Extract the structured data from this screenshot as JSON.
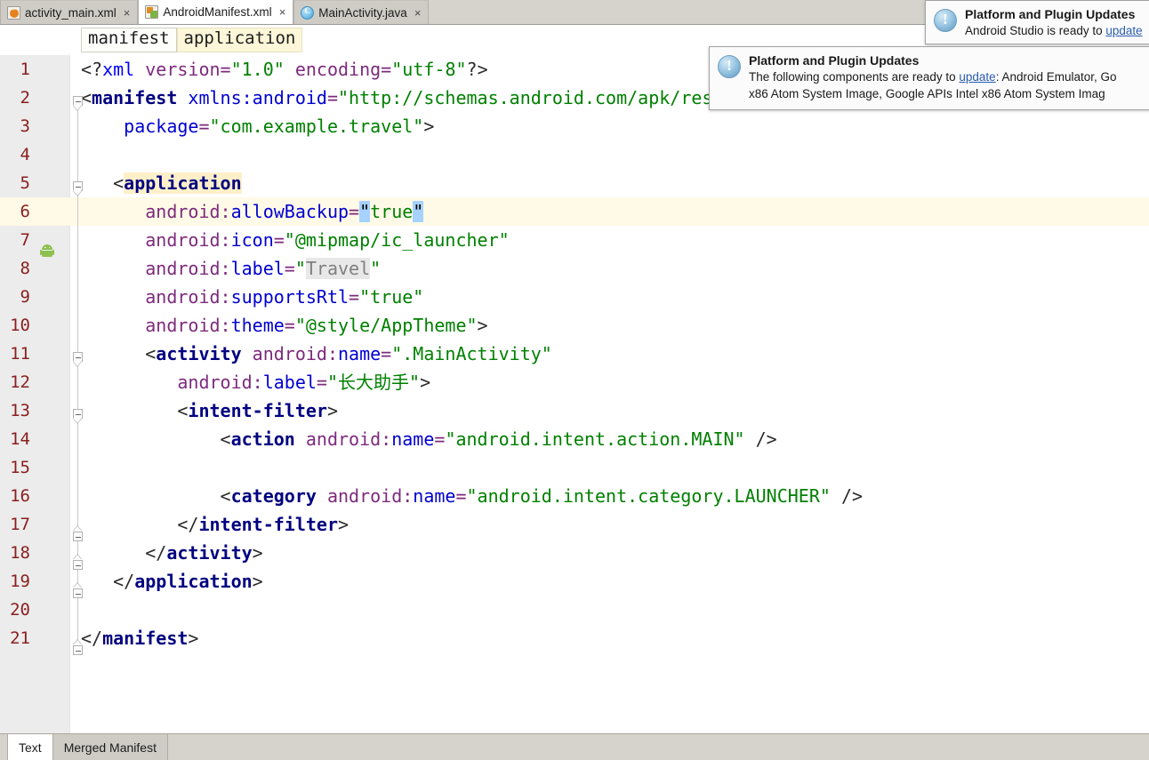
{
  "window": {
    "editor_tabs": [
      {
        "label": "activity_main.xml",
        "icon": "xml-file-icon",
        "active": false,
        "close": "×"
      },
      {
        "label": "AndroidManifest.xml",
        "icon": "android-manifest-icon",
        "active": true,
        "close": "×"
      },
      {
        "label": "MainActivity.java",
        "icon": "java-class-icon",
        "active": false,
        "close": "×"
      }
    ]
  },
  "breadcrumb": {
    "items": [
      {
        "label": "manifest",
        "highlight": false
      },
      {
        "label": "application",
        "highlight": true
      }
    ]
  },
  "editor": {
    "current_line": 6,
    "lines": [
      {
        "n": "1",
        "indent": 0
      },
      {
        "n": "2",
        "indent": 0
      },
      {
        "n": "3",
        "indent": 0
      },
      {
        "n": "4",
        "indent": 0
      },
      {
        "n": "5",
        "indent": 0
      },
      {
        "n": "6",
        "indent": 0
      },
      {
        "n": "7",
        "indent": 0
      },
      {
        "n": "8",
        "indent": 0
      },
      {
        "n": "9",
        "indent": 0
      },
      {
        "n": "10",
        "indent": 0
      },
      {
        "n": "11",
        "indent": 0
      },
      {
        "n": "12",
        "indent": 0
      },
      {
        "n": "13",
        "indent": 0
      },
      {
        "n": "14",
        "indent": 0
      },
      {
        "n": "15",
        "indent": 0
      },
      {
        "n": "16",
        "indent": 0
      },
      {
        "n": "17",
        "indent": 0
      },
      {
        "n": "18",
        "indent": 0
      },
      {
        "n": "19",
        "indent": 0
      },
      {
        "n": "20",
        "indent": 0
      },
      {
        "n": "21",
        "indent": 0
      }
    ],
    "code_text": {
      "l1": "<?xml version=\"1.0\" encoding=\"utf-8\"?>",
      "l2": "<manifest xmlns:android=\"http://schemas.android.com/apk/res/android\"",
      "l3": "        package=\"com.example.travel\">",
      "l4": "",
      "l5": "    <application",
      "l6": "        android:allowBackup=\"true\"",
      "l7": "        android:icon=\"@mipmap/ic_launcher\"",
      "l8": "        android:label=\"Travel\"",
      "l9": "        android:supportsRtl=\"true\"",
      "l10": "        android:theme=\"@style/AppTheme\">",
      "l11": "        <activity android:name=\".MainActivity\"",
      "l12": "            android:label=\"长大助手\">",
      "l13": "            <intent-filter>",
      "l14": "                <action android:name=\"android.intent.action.MAIN\" />",
      "l15": "",
      "l16": "                <category android:name=\"android.intent.category.LAUNCHER\" />",
      "l17": "            </intent-filter>",
      "l18": "        </activity>",
      "l19": "    </application>",
      "l20": "",
      "l21": "</manifest>"
    },
    "tokens": {
      "xml_decl_open": "<?",
      "xml_decl_name": "xml",
      "version_attr": " version=",
      "version_val": "\"1.0\"",
      "encoding_attr": " encoding=",
      "encoding_val": "\"utf-8\"",
      "xml_decl_close": "?>",
      "manifest_open": "<manifest",
      "xmlns_attr": " xmlns:android=",
      "xmlns_val": "\"http://schemas.android.com/apk/res/android\"",
      "package_attr": "package=",
      "package_val": "\"com.example.travel\"",
      "gt": ">",
      "application_open": "<application",
      "ns_android": "android:",
      "a_allowBackup": "allowBackup=",
      "v_true": "true",
      "quote": "\"",
      "a_icon": "icon=",
      "v_icon": "\"@mipmap/ic_launcher\"",
      "a_label": "label=",
      "v_travel": "\"Travel\"",
      "a_supportsRtl": "supportsRtl=",
      "v_true_q": "\"true\"",
      "a_theme": "theme=",
      "v_theme": "\"@style/AppTheme\"",
      "activity_open": "<activity",
      "a_name": "name=",
      "v_mainactivity": "\".MainActivity\"",
      "v_chinese_label": "\"长大助手\"",
      "intentfilter_open": "<intent-filter>",
      "action_open": "<action",
      "v_action_main": "\"android.intent.action.MAIN\"",
      "selfclose": " />",
      "category_open": "<category",
      "v_cat_launcher": "\"android.intent.category.LAUNCHER\"",
      "intentfilter_close": "</intent-filter>",
      "activity_close": "</activity>",
      "application_close": "</application>",
      "manifest_close": "</manifest>"
    },
    "gutter_icon_line": "7",
    "gutter_icon_name": "android-app-icon"
  },
  "notifications": [
    {
      "id": "notif-top-right",
      "title": "Platform and Plugin Updates",
      "body_prefix": "Android Studio is ready to ",
      "link": "update",
      "body_suffix": "",
      "icon": "info-icon"
    },
    {
      "id": "notif-main",
      "title": "Platform and Plugin Updates",
      "body_line1_prefix": "The following components are ready to ",
      "link": "update",
      "body_line1_suffix": ": Android Emulator, Go",
      "body_line2": "x86 Atom System Image, Google APIs Intel x86 Atom System Imag",
      "icon": "info-icon"
    }
  ],
  "bottom_tabs": [
    {
      "label": "Text",
      "active": true
    },
    {
      "label": "Merged Manifest",
      "active": false
    }
  ],
  "colors": {
    "tab_bar": "#d6d3cd",
    "current_line": "#fffae7",
    "selection": "#a6d2ff",
    "string": "#008000",
    "tag": "#000080",
    "attribute": "#7d2a7d",
    "namespace": "#0000d0",
    "line_number": "#8a1f1f",
    "link": "#2a5db0",
    "breadcrumb_highlight": "#fdf6d8"
  }
}
